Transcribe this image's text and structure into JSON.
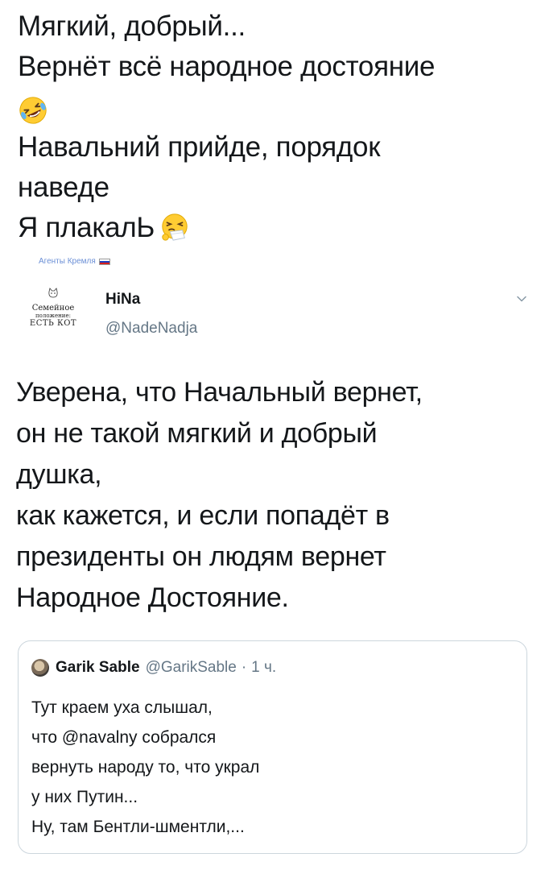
{
  "top_post": {
    "lines": [
      "Мягкий, добрый...",
      "Вернёт всё народное достояние",
      "Навальний прийде, порядок",
      "наведе",
      "Я плакалЬ"
    ],
    "emoji_after_line_2": "rolling-on-floor-laughing-emoji",
    "emoji_after_line_5": "sneezing-face-emoji"
  },
  "caption": {
    "text": "Агенты Кремля",
    "flag": "russian-flag-icon"
  },
  "tweet": {
    "avatar": {
      "line1": "Семейное",
      "line2": "положение:",
      "line3": "ЕСТЬ КОТ"
    },
    "display_name": "HiNa",
    "handle": "@NadeNadja",
    "menu_icon": "chevron-down-icon",
    "text_lines": [
      "Уверена, что Начальный вернет,",
      "он не такой мягкий и добрый",
      "душка,",
      "как кажется, и если попадёт в",
      "президенты он людям вернет",
      "Народное Достояние."
    ]
  },
  "quoted_tweet": {
    "name": "Garik Sable",
    "handle": "@GarikSable",
    "separator": "·",
    "time": "1 ч.",
    "text_lines": [
      "Тут краем уха слышал,",
      "что @navalny  собрался",
      "вернуть народу то, что украл",
      "у них Путин...",
      "Ну, там Бентли-шментли,..."
    ]
  },
  "colors": {
    "text": "#14171a",
    "secondary": "#657786",
    "caption": "#6b8fd6",
    "border": "#ccd6dd"
  }
}
